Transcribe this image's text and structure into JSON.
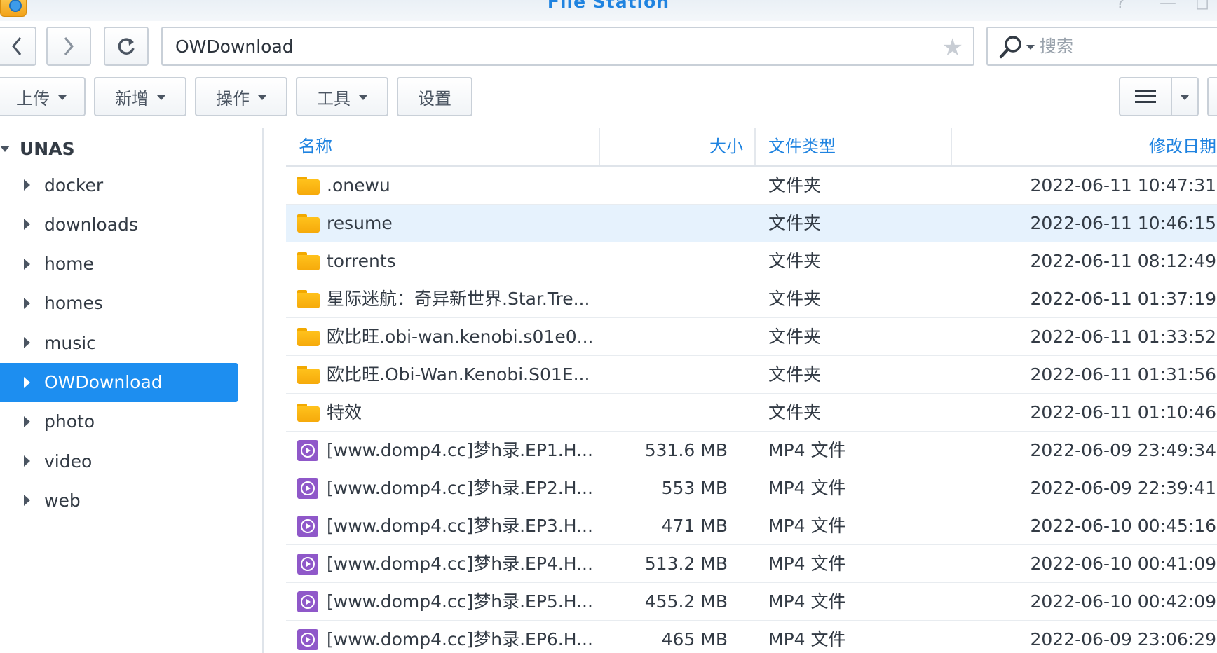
{
  "window": {
    "title": "File Station",
    "help_icon": "?",
    "minimize_icon": "—",
    "maximize_icon": "◻"
  },
  "nav": {
    "path": "OWDownload",
    "search_placeholder": "搜索"
  },
  "toolbar": {
    "upload": "上传",
    "create": "新增",
    "action": "操作",
    "tools": "工具",
    "settings": "设置"
  },
  "tree": {
    "root": "UNAS",
    "items": [
      {
        "label": "docker",
        "selected": false
      },
      {
        "label": "downloads",
        "selected": false
      },
      {
        "label": "home",
        "selected": false
      },
      {
        "label": "homes",
        "selected": false
      },
      {
        "label": "music",
        "selected": false
      },
      {
        "label": "OWDownload",
        "selected": true
      },
      {
        "label": "photo",
        "selected": false
      },
      {
        "label": "video",
        "selected": false
      },
      {
        "label": "web",
        "selected": false
      }
    ]
  },
  "list": {
    "columns": {
      "name": "名称",
      "size": "大小",
      "type": "文件类型",
      "modified": "修改日期"
    },
    "rows": [
      {
        "icon": "folder-icon",
        "name": ".onewu",
        "size": "",
        "type": "文件夹",
        "modified": "2022-06-11 10:47:31"
      },
      {
        "icon": "folder-icon",
        "name": "resume",
        "size": "",
        "type": "文件夹",
        "modified": "2022-06-11 10:46:15"
      },
      {
        "icon": "folder-icon",
        "name": "torrents",
        "size": "",
        "type": "文件夹",
        "modified": "2022-06-11 08:12:49"
      },
      {
        "icon": "folder-icon",
        "name": "星际迷航：奇异新世界.Star.Tre...",
        "size": "",
        "type": "文件夹",
        "modified": "2022-06-11 01:37:19"
      },
      {
        "icon": "folder-icon",
        "name": "欧比旺.obi-wan.kenobi.s01e0...",
        "size": "",
        "type": "文件夹",
        "modified": "2022-06-11 01:33:52"
      },
      {
        "icon": "folder-icon",
        "name": "欧比旺.Obi-Wan.Kenobi.S01E...",
        "size": "",
        "type": "文件夹",
        "modified": "2022-06-11 01:31:56"
      },
      {
        "icon": "folder-icon",
        "name": "特效",
        "size": "",
        "type": "文件夹",
        "modified": "2022-06-11 01:10:46"
      },
      {
        "icon": "video-file-icon",
        "name": "[www.domp4.cc]梦h录.EP1.H...",
        "size": "531.6 MB",
        "type": "MP4 文件",
        "modified": "2022-06-09 23:49:34"
      },
      {
        "icon": "video-file-icon",
        "name": "[www.domp4.cc]梦h录.EP2.H...",
        "size": "553 MB",
        "type": "MP4 文件",
        "modified": "2022-06-09 22:39:41"
      },
      {
        "icon": "video-file-icon",
        "name": "[www.domp4.cc]梦h录.EP3.H...",
        "size": "471 MB",
        "type": "MP4 文件",
        "modified": "2022-06-10 00:45:16"
      },
      {
        "icon": "video-file-icon",
        "name": "[www.domp4.cc]梦h录.EP4.H...",
        "size": "513.2 MB",
        "type": "MP4 文件",
        "modified": "2022-06-10 00:41:09"
      },
      {
        "icon": "video-file-icon",
        "name": "[www.domp4.cc]梦h录.EP5.H...",
        "size": "455.2 MB",
        "type": "MP4 文件",
        "modified": "2022-06-10 00:42:09"
      },
      {
        "icon": "video-file-icon",
        "name": "[www.domp4.cc]梦h录.EP6.H...",
        "size": "465 MB",
        "type": "MP4 文件",
        "modified": "2022-06-09 23:06:29"
      }
    ]
  },
  "colors": {
    "accent": "#1f83e0",
    "selected_bg": "#1d8ef0",
    "hover_row": "#e6f2fd",
    "folder": "#ffc21c",
    "video": "#8f58c9"
  }
}
